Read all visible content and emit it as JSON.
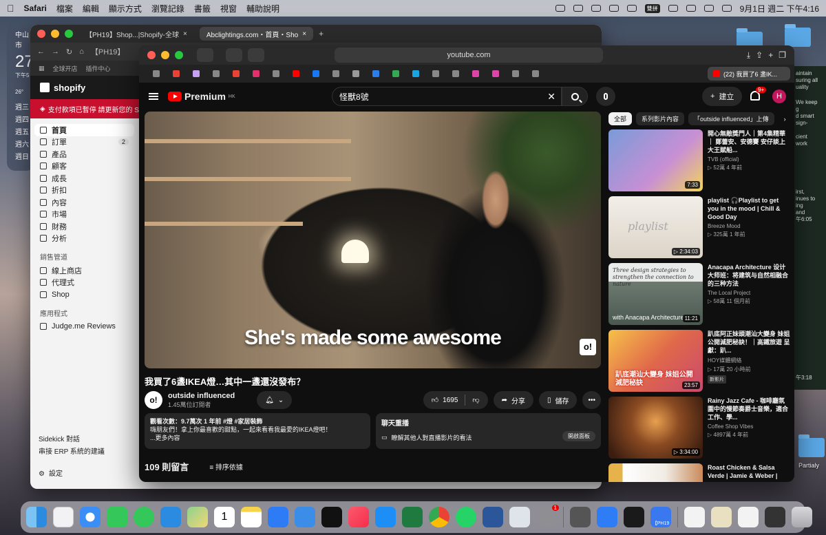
{
  "menubar": {
    "app": "Safari",
    "items": [
      "檔案",
      "編輯",
      "顯示方式",
      "瀏覽記錄",
      "書籤",
      "視窗",
      "輔助說明"
    ],
    "input_badge": "雙拼",
    "datetime": "9月1日 週二 下午4:16"
  },
  "weather": {
    "city": "中山市",
    "temp": "27",
    "sub": "下午5",
    "low": "26°",
    "days": [
      "週三",
      "週四",
      "週五",
      "週六",
      "週日"
    ]
  },
  "shopify_window": {
    "tabs": [
      "【PH19】Shop...|Shopify-全球",
      "Abclightings.com・首頁・Sho"
    ],
    "url": "【PH19】",
    "bookmarks": [
      "全球开店",
      "插件中心"
    ],
    "brand": "shopify",
    "alert": "支付款項已暫停 請更新您的 Shopif",
    "nav": [
      {
        "label": "首頁",
        "icon": "home-icon"
      },
      {
        "label": "訂單",
        "icon": "orders-icon",
        "badge": "2"
      },
      {
        "label": "產品",
        "icon": "tag-icon"
      },
      {
        "label": "顧客",
        "icon": "person-icon"
      },
      {
        "label": "成長",
        "icon": "growth-icon"
      },
      {
        "label": "折扣",
        "icon": "discount-icon"
      },
      {
        "label": "內容",
        "icon": "content-icon"
      },
      {
        "label": "市場",
        "icon": "globe-icon"
      },
      {
        "label": "財務",
        "icon": "bank-icon"
      },
      {
        "label": "分析",
        "icon": "chart-icon"
      }
    ],
    "sales_section": "銷售管道",
    "sales": [
      "線上商店",
      "代理式",
      "Shop"
    ],
    "apps_section": "應用程式",
    "apps": [
      "Judge.me Reviews"
    ],
    "sidekick": "Sidekick 對話",
    "erp": "串接 ERP 系統的建議",
    "settings": "設定"
  },
  "safari": {
    "url": "youtube.com",
    "current_tab": "(22) 我買了6 盞IK..."
  },
  "youtube": {
    "logo_text": "Premium",
    "region": "HK",
    "search_value": "怪獸8號",
    "create_label": "建立",
    "notification_count": "9+",
    "avatar_letter": "H",
    "video": {
      "caption": "She's made some awesome",
      "watermark": "o!",
      "title": "我買了6盞IKEA燈…其中一盞還沒發布？",
      "channel": "outside influenced",
      "channel_initial": "o!",
      "subscribers": "1.45萬位訂閱者",
      "likes": "1695",
      "share_label": "分享",
      "save_label": "儲存",
      "views_line": "觀看次數：9.7萬次 1 年前 #燈 #家居裝飾",
      "description": "嗨朋友們！拿上你最喜歡的甜點，一起來看看我最愛的IKEA燈吧！",
      "more": "...更多內容",
      "chat_title": "聊天重播",
      "chat_desc": "瞭解其他人對直播影片的看法",
      "chat_button": "開啟面板",
      "comment_count": "109 則留言",
      "sort_label": "排序依據"
    },
    "chips": [
      "全部",
      "系列影片內容",
      "「outside influenced」上傳"
    ],
    "recommendations": [
      {
        "title": "開心無敵獎門人｜第4集精華｜ 鄭蕾安、安德賽 安仔談上大王賦船...",
        "channel": "TVB (official)",
        "meta": "▷ 52萬 4 年前",
        "duration": "7:33",
        "color": "#7a9bd9"
      },
      {
        "title": "playlist 🎧Playlist to get you in the mood | Chill & Good Day",
        "channel": "Breeze Mood",
        "meta": "▷ 325萬 1 年前",
        "duration": "▷ 2:34:03",
        "color": "#e9e4dc"
      },
      {
        "title": "Anacapa Architecture 设计大师班：将建筑与自然相融合的三种方法",
        "channel": "The Local Project",
        "meta": "▷ 58萬 11 個月前",
        "duration": "11:21",
        "color": "#7f8a82",
        "thumb_text": "Three design strategies to strengthen the connection to nature",
        "thumb_text2": "with Anacapa Architecture"
      },
      {
        "title": "趴底阿正妹頭潮汕大變身 妹姐公開減肥秘訣！｜高鐵旅遊 呈獻：趴...",
        "channel": "HOY媒體網絡",
        "meta": "▷ 17萬 20 小時前",
        "badge": "新影片",
        "duration": "23:57",
        "color": "#c94a6e",
        "thumb_text": "趴底潮汕大變身 妹姐公開減肥秘訣"
      },
      {
        "title": "Rainy Jazz Cafe - 咖啡廳氛圍中的慢節奏爵士音樂，適合工作、學...",
        "channel": "Coffee Shop Vibes",
        "meta": "▷ 4897萬 4 年前",
        "duration": "▷ 3:34:00",
        "color": "#6b3b1f"
      },
      {
        "title": "Roast Chicken & Salsa Verde | Jamie & Weber |",
        "channel": "",
        "meta": "",
        "duration": "",
        "color": "#e6b24a"
      }
    ]
  },
  "right_panel": {
    "text": [
      "aintain",
      "suring all",
      "uality",
      "We keep",
      "g",
      "d smart",
      "sign-",
      "cient",
      "work",
      "irst,",
      "inues to",
      "ing",
      "and",
      "午6:05"
    ],
    "time2": "午3:18",
    "folder_label": "Partialy"
  },
  "dock": {
    "calendar_day": "1",
    "notification_badge": "1",
    "ph19_label": "【PH19"
  }
}
